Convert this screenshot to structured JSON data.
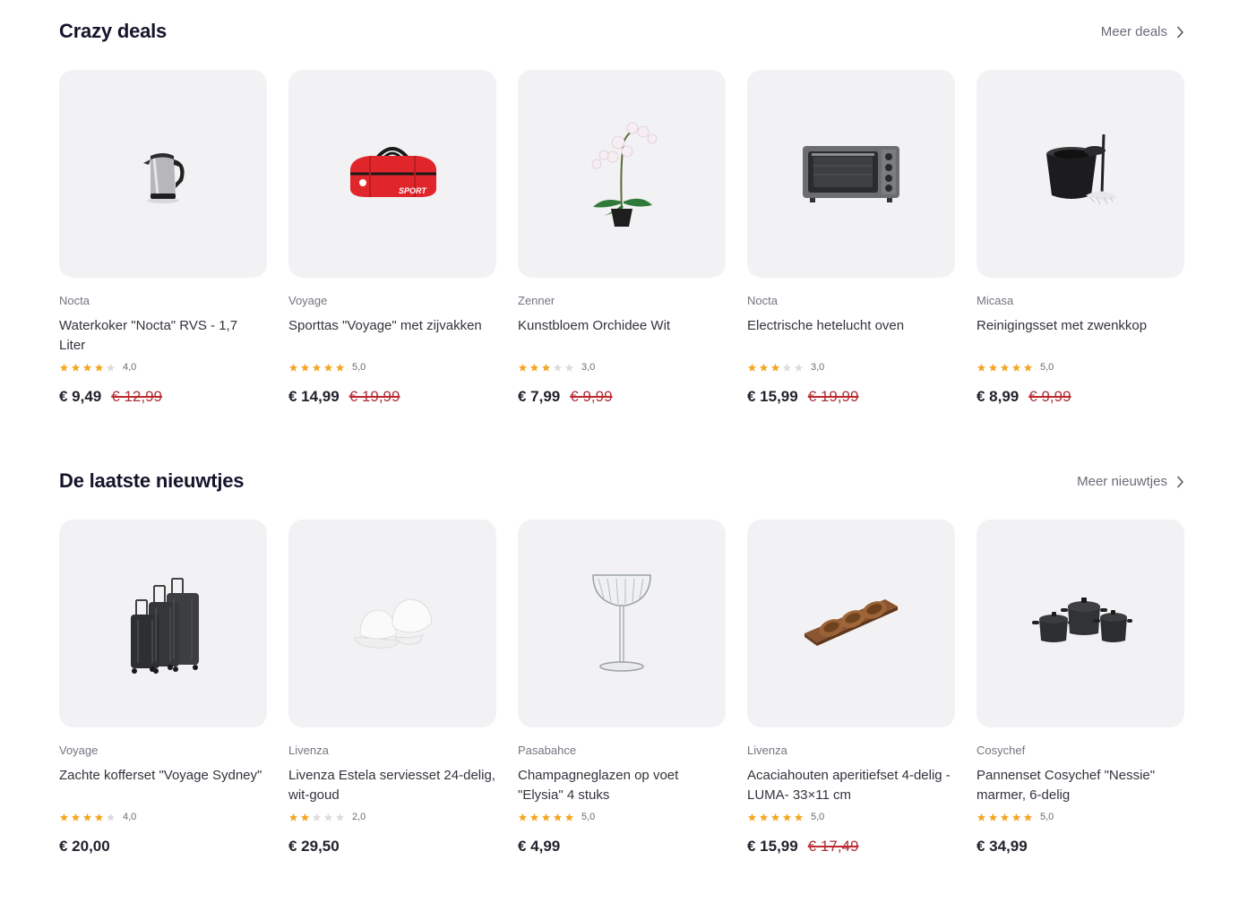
{
  "colors": {
    "accent_star": "#f5a623",
    "star_empty": "#dcdce0",
    "strike": "#c1272d",
    "card_bg": "#f2f2f4"
  },
  "sections": [
    {
      "title": "Crazy deals",
      "more_label": "Meer deals",
      "products": [
        {
          "brand": "Nocta",
          "name": "Waterkoker \"Nocta\" RVS - 1,7 Liter",
          "rating": 4,
          "rating_label": "4,0",
          "price": "€ 9,49",
          "old_price": "€ 12,99",
          "icon": "kettle-image"
        },
        {
          "brand": "Voyage",
          "name": "Sporttas \"Voyage\" met zijvakken",
          "rating": 5,
          "rating_label": "5,0",
          "price": "€ 14,99",
          "old_price": "€ 19,99",
          "icon": "sports-bag-image"
        },
        {
          "brand": "Zenner",
          "name": "Kunstbloem Orchidee Wit",
          "rating": 3,
          "rating_label": "3,0",
          "price": "€ 7,99",
          "old_price": "€ 9,99",
          "icon": "orchid-image"
        },
        {
          "brand": "Nocta",
          "name": "Electrische hetelucht oven",
          "rating": 3,
          "rating_label": "3,0",
          "price": "€ 15,99",
          "old_price": "€ 19,99",
          "icon": "oven-image"
        },
        {
          "brand": "Micasa",
          "name": "Reinigingsset met zwenkkop",
          "rating": 5,
          "rating_label": "5,0",
          "price": "€ 8,99",
          "old_price": "€ 9,99",
          "icon": "mop-bucket-image"
        }
      ]
    },
    {
      "title": "De laatste nieuwtjes",
      "more_label": "Meer nieuwtjes",
      "products": [
        {
          "brand": "Voyage",
          "name": "Zachte kofferset \"Voyage Sydney\"",
          "rating": 4,
          "rating_label": "4,0",
          "price": "€ 20,00",
          "old_price": "",
          "icon": "suitcase-set-image"
        },
        {
          "brand": "Livenza",
          "name": "Livenza Estela serviesset 24-delig, wit-goud",
          "rating": 2,
          "rating_label": "2,0",
          "price": "€ 29,50",
          "old_price": "",
          "icon": "dinnerware-image"
        },
        {
          "brand": "Pasabahce",
          "name": "Champagneglazen op voet \"Elysia\" 4 stuks",
          "rating": 5,
          "rating_label": "5,0",
          "price": "€ 4,99",
          "old_price": "",
          "icon": "champagne-glass-image"
        },
        {
          "brand": "Livenza",
          "name": "Acaciahouten aperitiefset 4-delig -LUMA- 33×11 cm",
          "rating": 5,
          "rating_label": "5,0",
          "price": "€ 15,99",
          "old_price": "€ 17,49",
          "icon": "wooden-tray-image"
        },
        {
          "brand": "Cosychef",
          "name": "Pannenset Cosychef \"Nessie\" marmer, 6-delig",
          "rating": 5,
          "rating_label": "5,0",
          "price": "€ 34,99",
          "old_price": "",
          "icon": "cookware-set-image"
        }
      ]
    }
  ]
}
